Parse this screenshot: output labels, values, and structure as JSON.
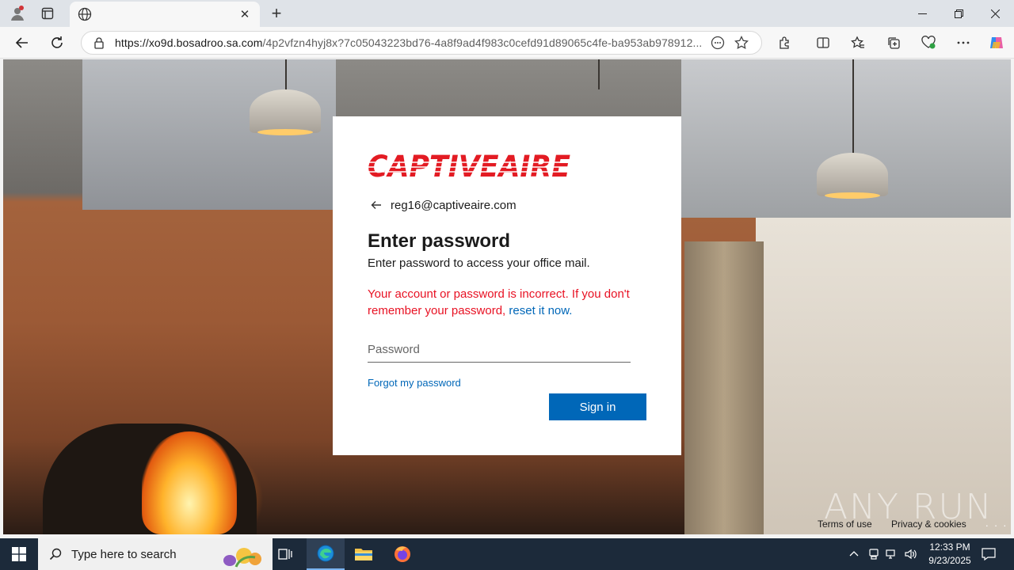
{
  "browser": {
    "tab_title": "",
    "url_host": "https://xo9d.bosadroo.sa.com",
    "url_path": "/4p2vfzn4hyj8x?7c05043223bd76-4a8f9ad4f983c0cefd91d89065c4fe-ba953ab978912..."
  },
  "login": {
    "brand": "CAPTIVEAIRE",
    "email": "reg16@captiveaire.com",
    "title": "Enter password",
    "subtitle": "Enter password to access your office mail.",
    "error_text": "Your account or password is incorrect. If you don't remember your password,",
    "error_link": "reset it now.",
    "password_placeholder": "Password",
    "forgot_link": "Forgot my password",
    "signin_label": "Sign in",
    "accent": "#0067b8",
    "error_color": "#e81123",
    "brand_color": "#e31b23"
  },
  "footer": {
    "terms": "Terms of use",
    "privacy": "Privacy & cookies",
    "more": ". . ."
  },
  "watermark": "ANY RUN",
  "taskbar": {
    "search_placeholder": "Type here to search",
    "time": "12:33 PM",
    "date": "9/23/2025"
  }
}
